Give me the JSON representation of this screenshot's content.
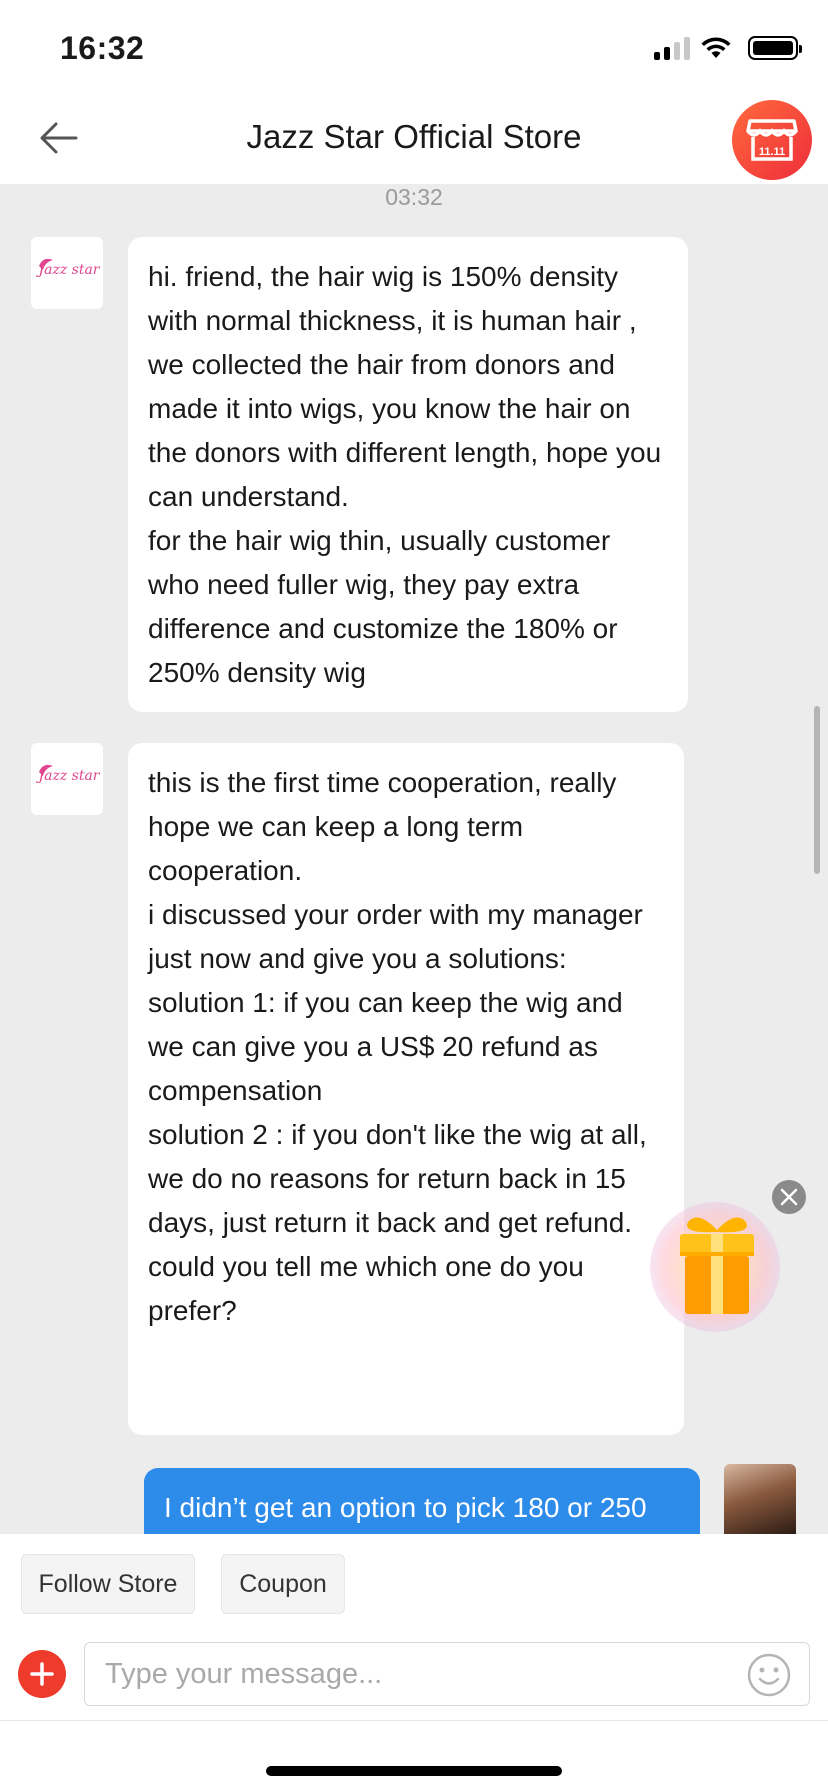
{
  "status_bar": {
    "time": "16:32"
  },
  "header": {
    "title": "Jazz Star Official Store",
    "back_icon": "arrow-left-icon",
    "store_icon": "storefront-icon",
    "store_badge_text": "11.11"
  },
  "chat": {
    "timestamp": "03:32",
    "brand_avatar_text": "Jazz star",
    "messages": [
      {
        "from": "store",
        "text": "hi. friend, the hair wig is 150% density with normal thickness, it is human hair , we collected the hair from donors and made it into wigs, you know the hair on the donors with different length, hope you can understand.\nfor the hair wig thin, usually customer who need fuller wig, they pay extra difference and customize the 180% or 250% density wig"
      },
      {
        "from": "store",
        "text": "this is the first time cooperation, really hope we can keep a long term cooperation.\ni discussed your order with my manager just now and give you a solutions:\nsolution 1: if you can keep the wig and we can give you a US$ 20 refund as compensation\nsolution 2 : if you don't like the wig at all, we do no reasons for return back in 15 days, just return it back and get refund.\ncould you tell me which one do you prefer?"
      },
      {
        "from": "user",
        "text": "I didn’t get an option to pick 180 or 250"
      }
    ]
  },
  "floating": {
    "gift_icon": "gift-box-icon",
    "close_icon": "close-icon"
  },
  "bottom": {
    "follow_label": "Follow Store",
    "coupon_label": "Coupon",
    "input_placeholder": "Type your message...",
    "plus_icon": "plus-icon",
    "emoji_icon": "smiley-icon"
  },
  "colors": {
    "accent_red": "#ee3b2c",
    "user_bubble": "#2d8bea",
    "brand_pink": "#e0468f",
    "chat_background": "#ececec"
  }
}
